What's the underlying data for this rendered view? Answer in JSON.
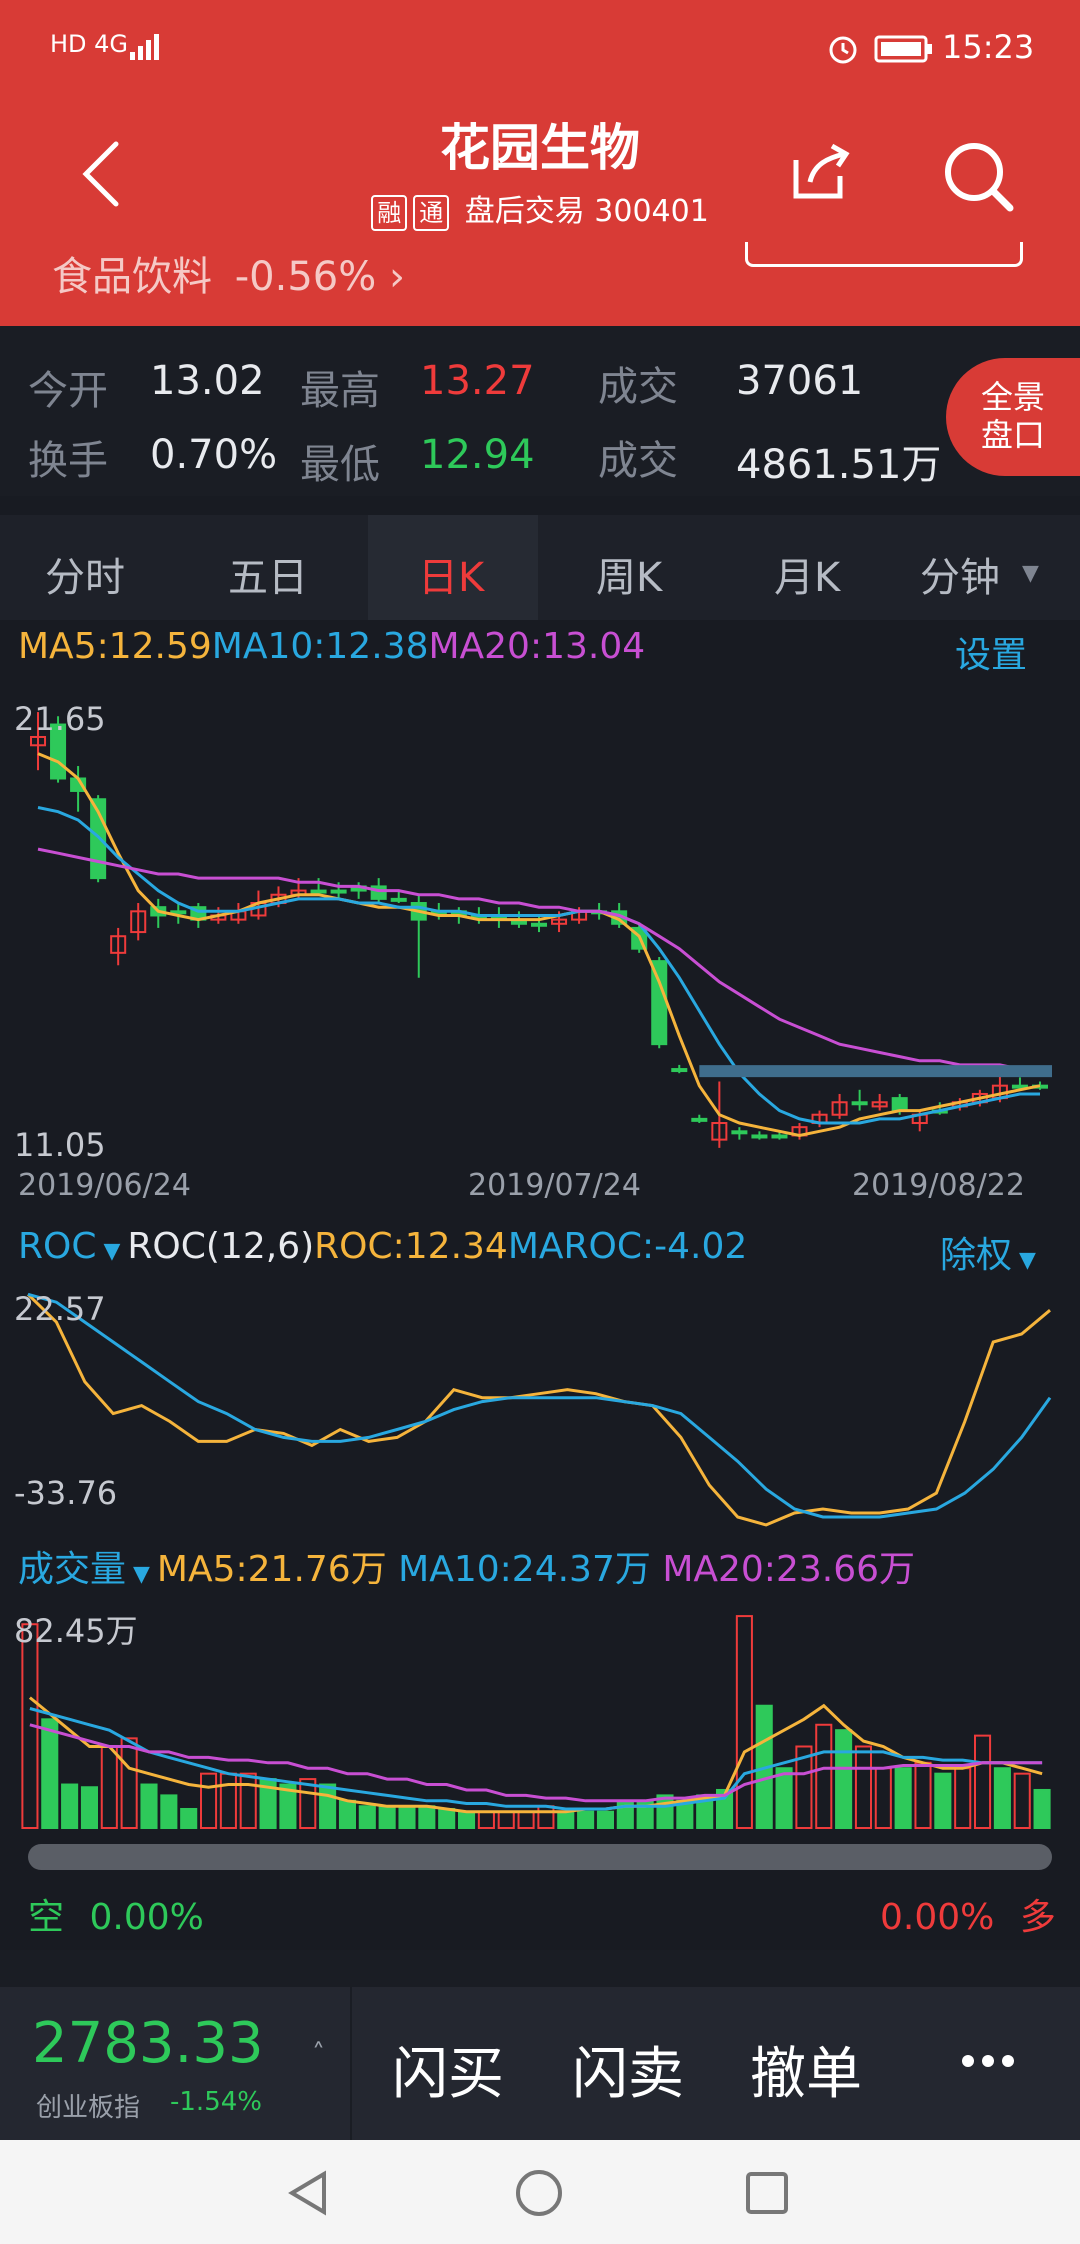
{
  "status_bar": {
    "left": "HD 4G",
    "time": "15:23"
  },
  "header": {
    "stock_name": "花园生物",
    "tags": [
      "融",
      "通"
    ],
    "trading_status": "盘后交易",
    "stock_code": "300401",
    "sector_name": "食品饮料",
    "sector_change": "-0.56%"
  },
  "quote": {
    "open_label": "今开",
    "open": "13.02",
    "high_label": "最高",
    "high": "13.27",
    "volume_label": "成交",
    "volume": "37061",
    "turnover_label": "换手",
    "turnover": "0.70%",
    "low_label": "最低",
    "low": "12.94",
    "amount_label": "成交",
    "amount": "4861.51万",
    "panorama_label_1": "全景",
    "panorama_label_2": "盘口"
  },
  "tabs": [
    "分时",
    "五日",
    "日K",
    "周K",
    "月K",
    "分钟"
  ],
  "active_tab": "日K",
  "kline": {
    "ma5": "MA5:12.59",
    "ma10": "MA10:12.38",
    "ma20": "MA20:13.04",
    "settings": "设置",
    "y_max": "21.65",
    "y_min": "11.05",
    "dates": [
      "2019/06/24",
      "2019/07/24",
      "2019/08/22"
    ]
  },
  "roc": {
    "name": "ROC",
    "params": "ROC(12,6)",
    "roc": "ROC:12.34",
    "maroc": "MAROC:-4.02",
    "adjust": "除权",
    "y_max": "22.57",
    "y_min": "-33.76"
  },
  "volume": {
    "name": "成交量",
    "ma5": "MA5:21.76万",
    "ma10": "MA10:24.37万",
    "ma20": "MA20:23.66万",
    "y_max": "82.45万"
  },
  "position": {
    "short_label": "空",
    "short_value": "0.00%",
    "long_value": "0.00%",
    "long_label": "多"
  },
  "bottom": {
    "index_value": "2783.33",
    "index_name": "创业板指",
    "index_change": "-1.54%",
    "buy": "闪买",
    "sell": "闪卖",
    "cancel": "撤单"
  },
  "colors": {
    "header": "#d83b36",
    "up": "#ef3b3b",
    "down": "#2ec95a",
    "ma5": "#f5b43c",
    "ma10": "#29a8e0",
    "ma20": "#c84fd3"
  },
  "chart_data": [
    {
      "type": "candlestick",
      "title": "",
      "ylim": [
        11.05,
        21.65
      ],
      "x_dates": [
        "2019/06/24",
        "2019/07/24",
        "2019/08/22"
      ],
      "candles": [
        {
          "o": 20.8,
          "c": 21.0,
          "h": 21.6,
          "l": 20.2,
          "up": true
        },
        {
          "o": 21.3,
          "c": 20.0,
          "h": 21.5,
          "l": 19.9,
          "up": false
        },
        {
          "o": 20.0,
          "c": 19.7,
          "h": 20.3,
          "l": 19.2,
          "up": false
        },
        {
          "o": 19.5,
          "c": 17.6,
          "h": 19.6,
          "l": 17.5,
          "up": false
        },
        {
          "o": 15.8,
          "c": 16.2,
          "h": 16.4,
          "l": 15.5,
          "up": true
        },
        {
          "o": 16.3,
          "c": 16.8,
          "h": 17.0,
          "l": 16.1,
          "up": true
        },
        {
          "o": 16.9,
          "c": 16.7,
          "h": 17.1,
          "l": 16.4,
          "up": false
        },
        {
          "o": 16.8,
          "c": 16.8,
          "h": 17.0,
          "l": 16.5,
          "up": false
        },
        {
          "o": 16.9,
          "c": 16.6,
          "h": 17.0,
          "l": 16.4,
          "up": false
        },
        {
          "o": 16.7,
          "c": 16.6,
          "h": 16.9,
          "l": 16.5,
          "up": true
        },
        {
          "o": 16.6,
          "c": 16.8,
          "h": 17.0,
          "l": 16.5,
          "up": true
        },
        {
          "o": 16.7,
          "c": 17.0,
          "h": 17.3,
          "l": 16.6,
          "up": true
        },
        {
          "o": 17.0,
          "c": 17.2,
          "h": 17.4,
          "l": 16.9,
          "up": true
        },
        {
          "o": 17.2,
          "c": 17.3,
          "h": 17.6,
          "l": 17.1,
          "up": true
        },
        {
          "o": 17.3,
          "c": 17.3,
          "h": 17.6,
          "l": 17.2,
          "up": false
        },
        {
          "o": 17.3,
          "c": 17.3,
          "h": 17.5,
          "l": 17.1,
          "up": false
        },
        {
          "o": 17.3,
          "c": 17.4,
          "h": 17.5,
          "l": 17.1,
          "up": false
        },
        {
          "o": 17.4,
          "c": 17.1,
          "h": 17.6,
          "l": 17.0,
          "up": false
        },
        {
          "o": 17.1,
          "c": 17.1,
          "h": 17.3,
          "l": 17.0,
          "up": false
        },
        {
          "o": 17.0,
          "c": 16.6,
          "h": 17.2,
          "l": 15.2,
          "up": false
        },
        {
          "o": 16.8,
          "c": 16.8,
          "h": 17.0,
          "l": 16.6,
          "up": false
        },
        {
          "o": 16.8,
          "c": 16.7,
          "h": 16.9,
          "l": 16.5,
          "up": false
        },
        {
          "o": 16.7,
          "c": 16.7,
          "h": 16.9,
          "l": 16.5,
          "up": false
        },
        {
          "o": 16.7,
          "c": 16.6,
          "h": 16.9,
          "l": 16.4,
          "up": false
        },
        {
          "o": 16.6,
          "c": 16.5,
          "h": 16.8,
          "l": 16.4,
          "up": false
        },
        {
          "o": 16.5,
          "c": 16.5,
          "h": 16.7,
          "l": 16.3,
          "up": false
        },
        {
          "o": 16.5,
          "c": 16.6,
          "h": 16.8,
          "l": 16.3,
          "up": true
        },
        {
          "o": 16.6,
          "c": 16.8,
          "h": 16.9,
          "l": 16.5,
          "up": true
        },
        {
          "o": 16.8,
          "c": 16.8,
          "h": 17.0,
          "l": 16.6,
          "up": false
        },
        {
          "o": 16.8,
          "c": 16.5,
          "h": 17.0,
          "l": 16.4,
          "up": false
        },
        {
          "o": 16.4,
          "c": 15.9,
          "h": 16.5,
          "l": 15.8,
          "up": false
        },
        {
          "o": 15.6,
          "c": 13.6,
          "h": 15.7,
          "l": 13.5,
          "up": false
        },
        {
          "o": 13.0,
          "c": 13.0,
          "h": 13.1,
          "l": 12.9,
          "up": false
        },
        {
          "o": 11.8,
          "c": 11.8,
          "h": 11.9,
          "l": 11.7,
          "up": false
        },
        {
          "o": 11.3,
          "c": 11.7,
          "h": 12.7,
          "l": 11.1,
          "up": true
        },
        {
          "o": 11.5,
          "c": 11.5,
          "h": 11.6,
          "l": 11.3,
          "up": false
        },
        {
          "o": 11.4,
          "c": 11.4,
          "h": 11.5,
          "l": 11.3,
          "up": false
        },
        {
          "o": 11.4,
          "c": 11.4,
          "h": 11.5,
          "l": 11.3,
          "up": false
        },
        {
          "o": 11.4,
          "c": 11.6,
          "h": 11.7,
          "l": 11.3,
          "up": true
        },
        {
          "o": 11.7,
          "c": 11.9,
          "h": 12.0,
          "l": 11.6,
          "up": true
        },
        {
          "o": 11.9,
          "c": 12.2,
          "h": 12.4,
          "l": 11.8,
          "up": true
        },
        {
          "o": 12.2,
          "c": 12.2,
          "h": 12.5,
          "l": 12.0,
          "up": false
        },
        {
          "o": 12.2,
          "c": 12.1,
          "h": 12.4,
          "l": 12.0,
          "up": true
        },
        {
          "o": 12.3,
          "c": 12.0,
          "h": 12.4,
          "l": 11.9,
          "up": false
        },
        {
          "o": 11.7,
          "c": 11.9,
          "h": 12.0,
          "l": 11.5,
          "up": true
        },
        {
          "o": 12.0,
          "c": 12.0,
          "h": 12.2,
          "l": 11.9,
          "up": false
        },
        {
          "o": 12.1,
          "c": 12.2,
          "h": 12.3,
          "l": 12.0,
          "up": true
        },
        {
          "o": 12.2,
          "c": 12.4,
          "h": 12.5,
          "l": 12.1,
          "up": true
        },
        {
          "o": 12.3,
          "c": 12.6,
          "h": 12.9,
          "l": 12.2,
          "up": true
        },
        {
          "o": 12.6,
          "c": 12.6,
          "h": 12.8,
          "l": 12.5,
          "up": false
        },
        {
          "o": 12.6,
          "c": 12.6,
          "h": 12.7,
          "l": 12.5,
          "up": false
        }
      ],
      "ma5": [
        20.6,
        20.4,
        20.0,
        19.2,
        18.2,
        17.3,
        16.8,
        16.7,
        16.6,
        16.7,
        16.8,
        17.0,
        17.1,
        17.2,
        17.2,
        17.1,
        17.0,
        16.9,
        16.9,
        16.8,
        16.7,
        16.7,
        16.6,
        16.6,
        16.6,
        16.6,
        16.7,
        16.8,
        16.8,
        16.6,
        16.2,
        15.1,
        13.8,
        12.6,
        11.9,
        11.7,
        11.6,
        11.5,
        11.4,
        11.5,
        11.6,
        11.8,
        11.9,
        12.0,
        12.0,
        12.1,
        12.2,
        12.3,
        12.4,
        12.5,
        12.6
      ],
      "ma10": [
        19.3,
        19.2,
        19.0,
        18.6,
        18.1,
        17.7,
        17.3,
        17.0,
        16.8,
        16.8,
        16.8,
        16.9,
        17.0,
        17.1,
        17.1,
        17.1,
        17.0,
        17.0,
        16.9,
        16.9,
        16.8,
        16.8,
        16.7,
        16.7,
        16.7,
        16.7,
        16.7,
        16.8,
        16.8,
        16.7,
        16.5,
        15.9,
        15.2,
        14.4,
        13.6,
        12.9,
        12.4,
        12.0,
        11.8,
        11.7,
        11.7,
        11.7,
        11.8,
        11.8,
        11.9,
        12.0,
        12.1,
        12.2,
        12.3,
        12.4,
        12.4
      ],
      "ma20": [
        18.3,
        18.2,
        18.1,
        18.0,
        17.9,
        17.8,
        17.7,
        17.7,
        17.6,
        17.6,
        17.6,
        17.6,
        17.6,
        17.5,
        17.5,
        17.4,
        17.4,
        17.3,
        17.3,
        17.2,
        17.2,
        17.1,
        17.1,
        17.0,
        17.0,
        16.9,
        16.9,
        16.8,
        16.8,
        16.7,
        16.5,
        16.2,
        15.9,
        15.5,
        15.1,
        14.8,
        14.5,
        14.2,
        14.0,
        13.8,
        13.6,
        13.5,
        13.4,
        13.3,
        13.2,
        13.2,
        13.1,
        13.1,
        13.1,
        13.0,
        13.0
      ]
    },
    {
      "type": "line",
      "title": "ROC(12,6)",
      "ylim": [
        -33.76,
        22.57
      ],
      "series": [
        {
          "name": "ROC",
          "values": [
            22.0,
            15.0,
            0.0,
            -8.0,
            -6.0,
            -10.0,
            -15.0,
            -15.0,
            -12.0,
            -13.0,
            -16.0,
            -12.0,
            -15.0,
            -14.0,
            -10.0,
            -2.0,
            -4.0,
            -4.0,
            -3.0,
            -2.0,
            -3.0,
            -5.0,
            -6.0,
            -14.0,
            -26.0,
            -34.0,
            -36.0,
            -33.0,
            -32.0,
            -33.0,
            -33.0,
            -32.0,
            -28.0,
            -10.0,
            10.0,
            12.0,
            18.0
          ]
        },
        {
          "name": "MAROC",
          "values": [
            22.0,
            20.0,
            15.0,
            10.0,
            5.0,
            0.0,
            -5.0,
            -8.0,
            -12.0,
            -14.0,
            -15.0,
            -15.0,
            -14.0,
            -12.0,
            -10.0,
            -7.0,
            -5.0,
            -4.0,
            -4.0,
            -4.0,
            -4.0,
            -5.0,
            -6.0,
            -8.0,
            -14.0,
            -20.0,
            -27.0,
            -32.0,
            -34.0,
            -34.0,
            -34.0,
            -33.0,
            -32.0,
            -28.0,
            -22.0,
            -14.0,
            -4.0
          ]
        }
      ]
    },
    {
      "type": "bar",
      "title": "成交量",
      "ylim": [
        0,
        82.45
      ],
      "values": [
        75,
        40,
        16,
        15,
        30,
        33,
        16,
        12,
        7,
        20,
        20,
        20,
        18,
        16,
        18,
        16,
        10,
        8,
        8,
        8,
        8,
        7,
        6,
        6,
        6,
        6,
        8,
        6,
        6,
        6,
        10,
        10,
        12,
        10,
        12,
        14,
        78,
        45,
        22,
        30,
        38,
        36,
        30,
        22,
        22,
        24,
        20,
        22,
        34,
        22,
        20,
        14
      ],
      "up": [
        true,
        false,
        false,
        false,
        true,
        true,
        false,
        false,
        false,
        true,
        true,
        true,
        false,
        false,
        true,
        false,
        false,
        false,
        false,
        false,
        false,
        false,
        false,
        true,
        true,
        true,
        true,
        false,
        false,
        false,
        false,
        false,
        false,
        false,
        false,
        false,
        true,
        false,
        false,
        true,
        true,
        false,
        true,
        true,
        false,
        true,
        false,
        true,
        true,
        false,
        true,
        false
      ],
      "series": [
        {
          "name": "MA5",
          "values": [
            48,
            42,
            36,
            30,
            30,
            22,
            20,
            18,
            16,
            15,
            16,
            16,
            15,
            14,
            13,
            12,
            10,
            9,
            8,
            8,
            8,
            7,
            6,
            6,
            6,
            6,
            6,
            6,
            7,
            7,
            8,
            8,
            9,
            10,
            11,
            12,
            28,
            32,
            36,
            40,
            45,
            38,
            32,
            30,
            26,
            24,
            22,
            22,
            24,
            24,
            22,
            20
          ]
        },
        {
          "name": "MA10",
          "values": [
            44,
            42,
            40,
            38,
            36,
            32,
            28,
            26,
            24,
            22,
            20,
            19,
            18,
            17,
            16,
            15,
            14,
            13,
            12,
            11,
            10,
            10,
            9,
            9,
            8,
            8,
            8,
            7,
            7,
            7,
            8,
            8,
            8,
            9,
            10,
            11,
            20,
            22,
            24,
            26,
            28,
            28,
            28,
            28,
            26,
            26,
            25,
            25,
            24,
            24,
            24,
            24
          ]
        },
        {
          "name": "MA20",
          "values": [
            38,
            36,
            34,
            32,
            30,
            30,
            28,
            28,
            26,
            26,
            25,
            25,
            24,
            24,
            22,
            22,
            20,
            20,
            18,
            18,
            16,
            16,
            14,
            14,
            12,
            12,
            11,
            11,
            10,
            10,
            10,
            10,
            11,
            11,
            12,
            12,
            16,
            18,
            20,
            20,
            22,
            22,
            22,
            22,
            23,
            23,
            23,
            23,
            24,
            24,
            24,
            24
          ]
        }
      ]
    }
  ]
}
